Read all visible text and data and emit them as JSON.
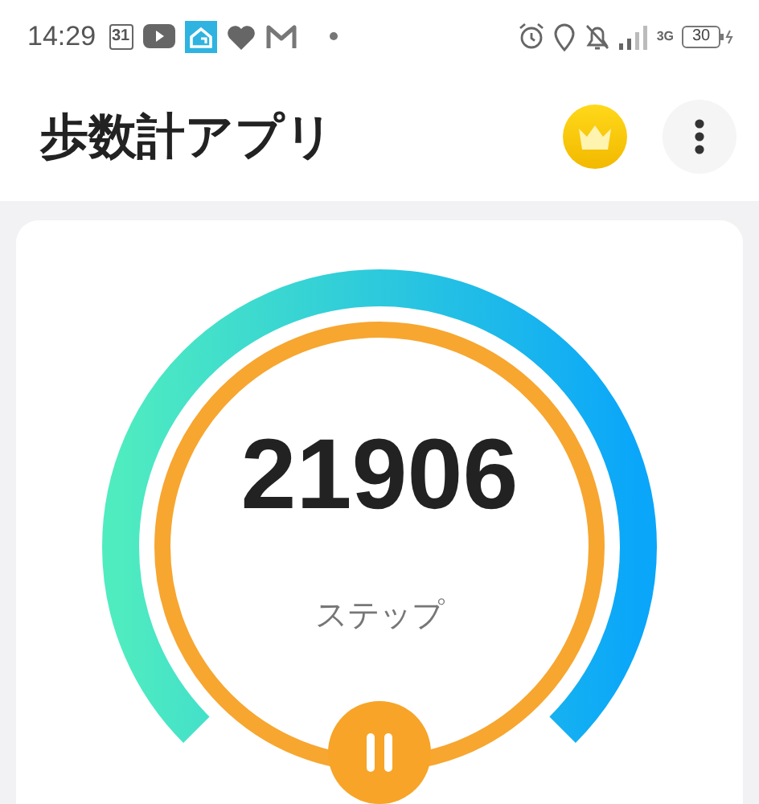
{
  "status_bar": {
    "time": "14:29",
    "calendar_day": "31",
    "network": "3G",
    "battery": "30"
  },
  "app_bar": {
    "title": "歩数計アプリ"
  },
  "step_counter": {
    "steps": "21906",
    "unit": "ステップ"
  }
}
